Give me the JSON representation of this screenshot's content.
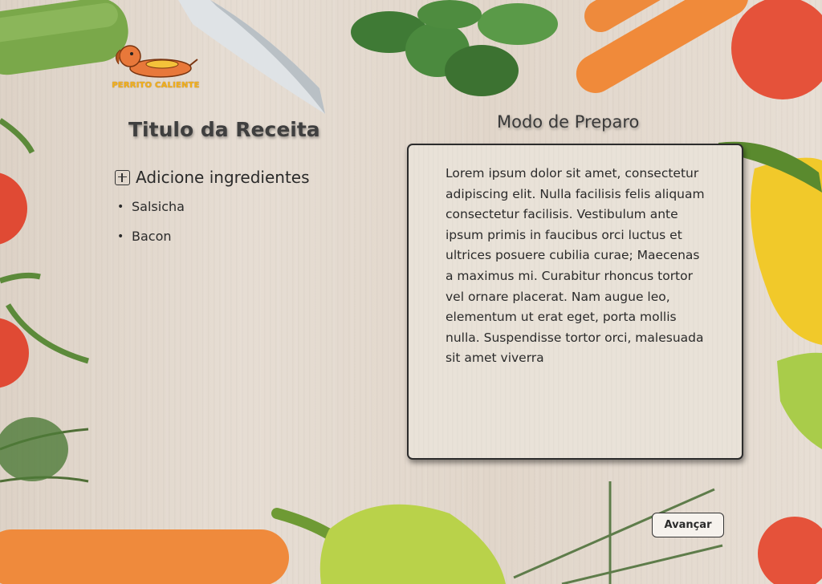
{
  "logo": {
    "text": "PERRITO CALIENTE"
  },
  "recipe": {
    "title": "Titulo da Receita",
    "add_ingredients_label": "Adicione ingredientes",
    "ingredients": [
      "Salsicha",
      "Bacon"
    ],
    "bullet": "•"
  },
  "preparation": {
    "title": "Modo de Preparo",
    "text": "Lorem ipsum dolor sit amet, consectetur adipiscing elit. Nulla facilisis felis aliquam consectetur facilisis. Vestibulum ante ipsum primis in faucibus orci luctus et ultrices posuere cubilia curae; Maecenas a maximus mi. Curabitur rhoncus tortor vel ornare placerat. Nam augue leo, elementum ut erat eget, porta mollis nulla. Suspendisse tortor orci, malesuada sit amet viverra"
  },
  "actions": {
    "next_label": "Avançar"
  },
  "colors": {
    "background": "#e3d9cd",
    "text": "#2a2a2a",
    "logo_text": "#f2b11b",
    "logo_dog": "#e8783a"
  }
}
